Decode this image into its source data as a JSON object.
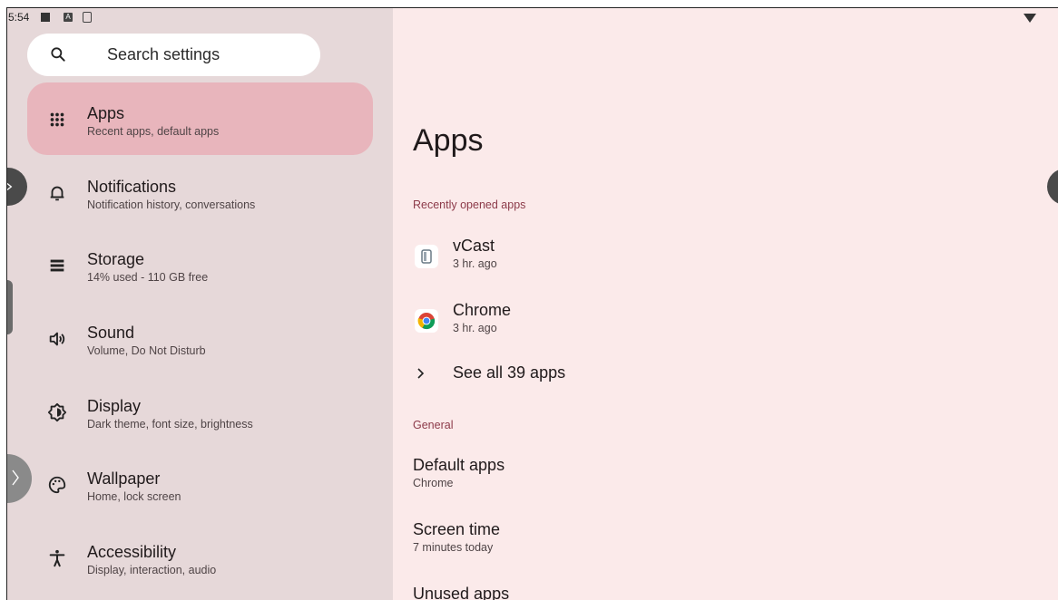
{
  "status_bar": {
    "time": "5:54"
  },
  "search": {
    "placeholder": "Search settings",
    "icon": "search-icon"
  },
  "sidebar": {
    "items": [
      {
        "title": "Apps",
        "subtitle": "Recent apps, default apps",
        "icon": "apps-grid-icon",
        "active": true
      },
      {
        "title": "Notifications",
        "subtitle": "Notification history, conversations",
        "icon": "bell-icon"
      },
      {
        "title": "Storage",
        "subtitle": "14% used - 110 GB free",
        "icon": "storage-icon"
      },
      {
        "title": "Sound",
        "subtitle": "Volume, Do Not Disturb",
        "icon": "speaker-icon"
      },
      {
        "title": "Display",
        "subtitle": "Dark theme, font size, brightness",
        "icon": "brightness-icon"
      },
      {
        "title": "Wallpaper",
        "subtitle": "Home, lock screen",
        "icon": "palette-icon"
      },
      {
        "title": "Accessibility",
        "subtitle": "Display, interaction, audio",
        "icon": "accessibility-icon"
      }
    ]
  },
  "main": {
    "title": "Apps",
    "recent_section": "Recently opened apps",
    "recent_apps": [
      {
        "name": "vCast",
        "time": "3 hr. ago",
        "icon": "vcast-icon"
      },
      {
        "name": "Chrome",
        "time": "3 hr. ago",
        "icon": "chrome-icon"
      }
    ],
    "see_all": "See all 39 apps",
    "general_section": "General",
    "general_items": [
      {
        "title": "Default apps",
        "subtitle": "Chrome"
      },
      {
        "title": "Screen time",
        "subtitle": "7 minutes today"
      },
      {
        "title": "Unused apps",
        "subtitle": ""
      }
    ]
  },
  "colors": {
    "left_pane": "#e6d8d9",
    "right_pane": "#fbeaea",
    "active_item": "#e8b5bc",
    "section_header": "#8c3a49"
  }
}
